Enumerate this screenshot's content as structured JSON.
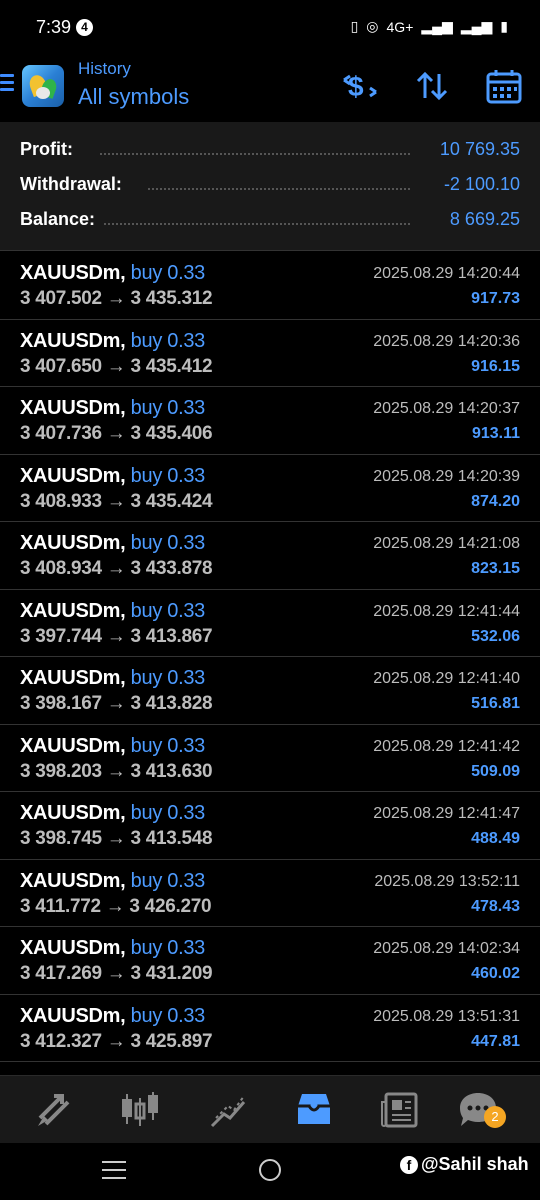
{
  "status_bar": {
    "time": "7:39",
    "notif_count": "4",
    "network": "4G+"
  },
  "header": {
    "subtitle": "History",
    "title": "All symbols"
  },
  "summary": [
    {
      "label": "Profit:",
      "value": "10 769.35"
    },
    {
      "label": "Withdrawal:",
      "value": "-2 100.10"
    },
    {
      "label": "Balance:",
      "value": "8 669.25"
    }
  ],
  "trades": [
    {
      "symbol": "XAUUSDm,",
      "type": "buy 0.33",
      "prices": "3 407.502 → 3 435.312",
      "time": "2025.08.29 14:20:44",
      "profit": "917.73"
    },
    {
      "symbol": "XAUUSDm,",
      "type": "buy 0.33",
      "prices": "3 407.650 → 3 435.412",
      "time": "2025.08.29 14:20:36",
      "profit": "916.15"
    },
    {
      "symbol": "XAUUSDm,",
      "type": "buy 0.33",
      "prices": "3 407.736 → 3 435.406",
      "time": "2025.08.29 14:20:37",
      "profit": "913.11"
    },
    {
      "symbol": "XAUUSDm,",
      "type": "buy 0.33",
      "prices": "3 408.933 → 3 435.424",
      "time": "2025.08.29 14:20:39",
      "profit": "874.20"
    },
    {
      "symbol": "XAUUSDm,",
      "type": "buy 0.33",
      "prices": "3 408.934 → 3 433.878",
      "time": "2025.08.29 14:21:08",
      "profit": "823.15"
    },
    {
      "symbol": "XAUUSDm,",
      "type": "buy 0.33",
      "prices": "3 397.744 → 3 413.867",
      "time": "2025.08.29 12:41:44",
      "profit": "532.06"
    },
    {
      "symbol": "XAUUSDm,",
      "type": "buy 0.33",
      "prices": "3 398.167 → 3 413.828",
      "time": "2025.08.29 12:41:40",
      "profit": "516.81"
    },
    {
      "symbol": "XAUUSDm,",
      "type": "buy 0.33",
      "prices": "3 398.203 → 3 413.630",
      "time": "2025.08.29 12:41:42",
      "profit": "509.09"
    },
    {
      "symbol": "XAUUSDm,",
      "type": "buy 0.33",
      "prices": "3 398.745 → 3 413.548",
      "time": "2025.08.29 12:41:47",
      "profit": "488.49"
    },
    {
      "symbol": "XAUUSDm,",
      "type": "buy 0.33",
      "prices": "3 411.772 → 3 426.270",
      "time": "2025.08.29 13:52:11",
      "profit": "478.43"
    },
    {
      "symbol": "XAUUSDm,",
      "type": "buy 0.33",
      "prices": "3 417.269 → 3 431.209",
      "time": "2025.08.29 14:02:34",
      "profit": "460.02"
    },
    {
      "symbol": "XAUUSDm,",
      "type": "buy 0.33",
      "prices": "3 412.327 → 3 425.897",
      "time": "2025.08.29 13:51:31",
      "profit": "447.81"
    }
  ],
  "bottom_nav": {
    "items": [
      "quotes-icon",
      "chart-icon",
      "trade-icon",
      "history-icon",
      "news-icon",
      "chat-icon"
    ],
    "active": "history-icon",
    "chat_badge": "2"
  },
  "watermark": "@Sahil shah",
  "colors": {
    "accent": "#4d9bff",
    "background": "#000000",
    "panel": "#191919",
    "badge": "#f5a623"
  }
}
